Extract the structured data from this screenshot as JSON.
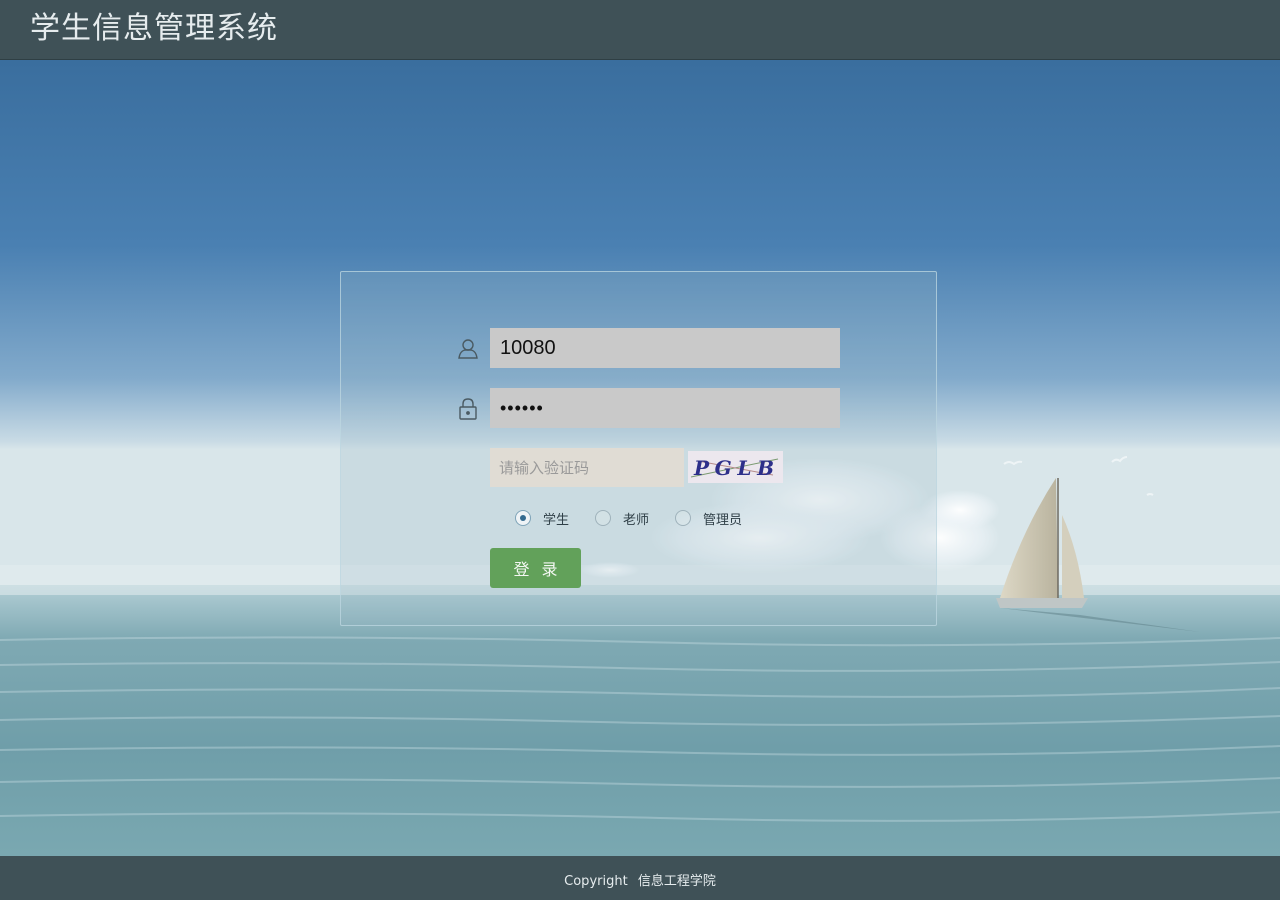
{
  "header": {
    "title": "学生信息管理系统"
  },
  "login": {
    "username_value": "10080",
    "password_value": "••••••",
    "captcha_placeholder": "请输入验证码",
    "captcha_text": "PGLB",
    "roles": [
      {
        "label": "学生",
        "checked": true
      },
      {
        "label": "老师",
        "checked": false
      },
      {
        "label": "管理员",
        "checked": false
      }
    ],
    "submit_label": "登录"
  },
  "footer": {
    "copyright_label": "Copyright",
    "org_name": "信息工程学院"
  },
  "colors": {
    "header_bg": "#3f5157",
    "button_bg": "#62a15a",
    "input_bg": "#c9c9c9"
  },
  "icons": [
    "user-icon",
    "lock-icon"
  ]
}
